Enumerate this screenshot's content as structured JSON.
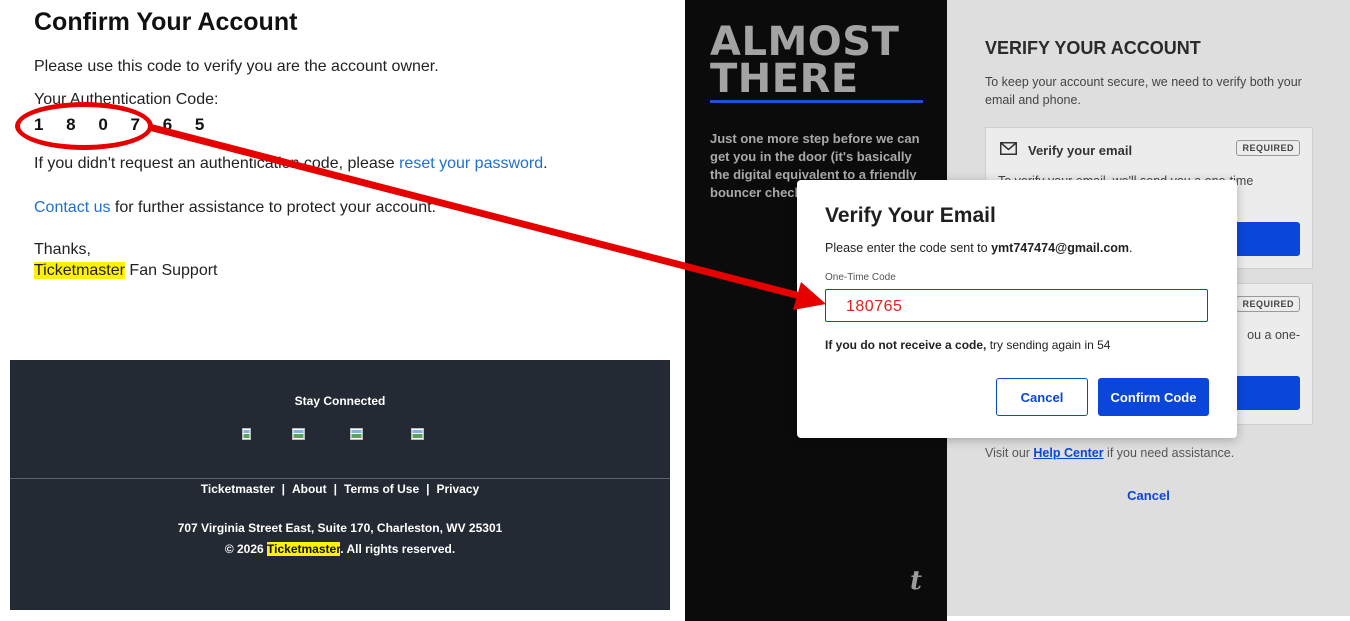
{
  "email": {
    "title": "Confirm Your Account",
    "intro": "Please use this code to verify you are the account owner.",
    "code_label": "Your Authentication Code:",
    "code": "1 8 0 7 6 5",
    "reset_prefix": "If you didn't request an authentication code, please ",
    "reset_link": "reset your password",
    "reset_suffix": ".",
    "contact_link": "Contact us",
    "contact_suffix": " for further assistance to protect your account.",
    "thanks": "Thanks,",
    "signature_brand": "Ticketmaster",
    "signature_suffix": " Fan Support",
    "footer": {
      "stay_connected": "Stay Connected",
      "links": [
        "Ticketmaster",
        "About",
        "Terms of Use",
        "Privacy"
      ],
      "address": "707 Virginia Street East, Suite 170, Charleston, WV 25301",
      "copyright_prefix": "© 2026 ",
      "copyright_brand": "Ticketmaster",
      "copyright_suffix": ". All rights reserved."
    }
  },
  "app": {
    "hero_line1": "ALMOST",
    "hero_line2": "THERE",
    "hero_text": "Just one more step before we can get you in the door (it's basically the digital equivalent to a friendly bouncer check",
    "logo_letter": "t",
    "verify_title": "VERIFY YOUR ACCOUNT",
    "verify_desc": "To keep your account secure, we need to verify both your email and phone.",
    "email_card_label": "Verify your email",
    "required_badge": "REQUIRED",
    "email_card_text": "To verify your email, we'll send you a one-time",
    "phone_card_text": "ou a one-",
    "help_prefix": "Visit our ",
    "help_link": "Help Center",
    "help_suffix": " if you need assistance.",
    "cancel_link": "Cancel"
  },
  "modal": {
    "title": "Verify Your Email",
    "desc_prefix": "Please enter the code sent to ",
    "desc_email": "ymt747474@gmail.com",
    "desc_suffix": ".",
    "input_label": "One-Time Code",
    "input_value": "180765",
    "help_bold": "If you do not receive a code,",
    "help_rest": " try sending again in 54",
    "cancel_button": "Cancel",
    "confirm_button": "Confirm Code"
  },
  "colors": {
    "annotation_red": "#e60000",
    "brand_blue": "#0a46d9",
    "highlight_yellow": "#fff200"
  }
}
